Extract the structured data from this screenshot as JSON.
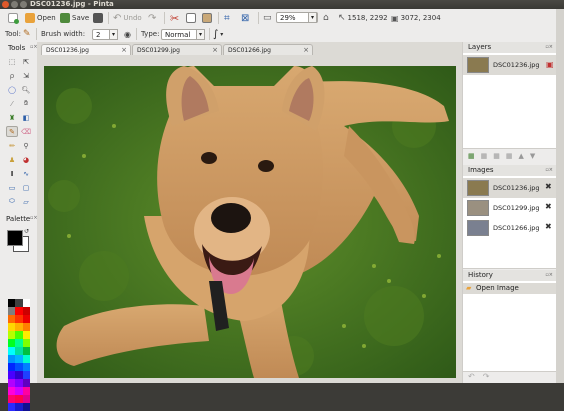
{
  "window": {
    "title": "DSC01236.jpg - Pinta"
  },
  "toolbar": {
    "open_label": "Open",
    "save_label": "Save",
    "undo_label": "Undo",
    "zoom_value": "29%",
    "cursor_pos": "1518, 2292",
    "image_size": "3072, 2304"
  },
  "options": {
    "tool_label": "Tool:",
    "brush_width_label": "Brush width:",
    "brush_width_value": "2",
    "type_label": "Type:",
    "type_value": "Normal"
  },
  "tools_panel": {
    "title": "Tools"
  },
  "palette_panel": {
    "title": "Palette"
  },
  "tabs": [
    {
      "label": "DSC01236.jpg"
    },
    {
      "label": "DSC01299.jpg"
    },
    {
      "label": "DSC01266.jpg"
    }
  ],
  "layers": {
    "title": "Layers",
    "items": [
      {
        "name": "DSC01236.jpg"
      }
    ]
  },
  "images": {
    "title": "Images",
    "items": [
      {
        "name": "DSC01236.jpg"
      },
      {
        "name": "DSC01299.jpg"
      },
      {
        "name": "DSC01266.jpg"
      }
    ]
  },
  "history": {
    "title": "History",
    "items": [
      {
        "label": "Open Image"
      }
    ]
  },
  "colors": {
    "accent": "#dd4814",
    "titlebar": "#3c3b37"
  }
}
